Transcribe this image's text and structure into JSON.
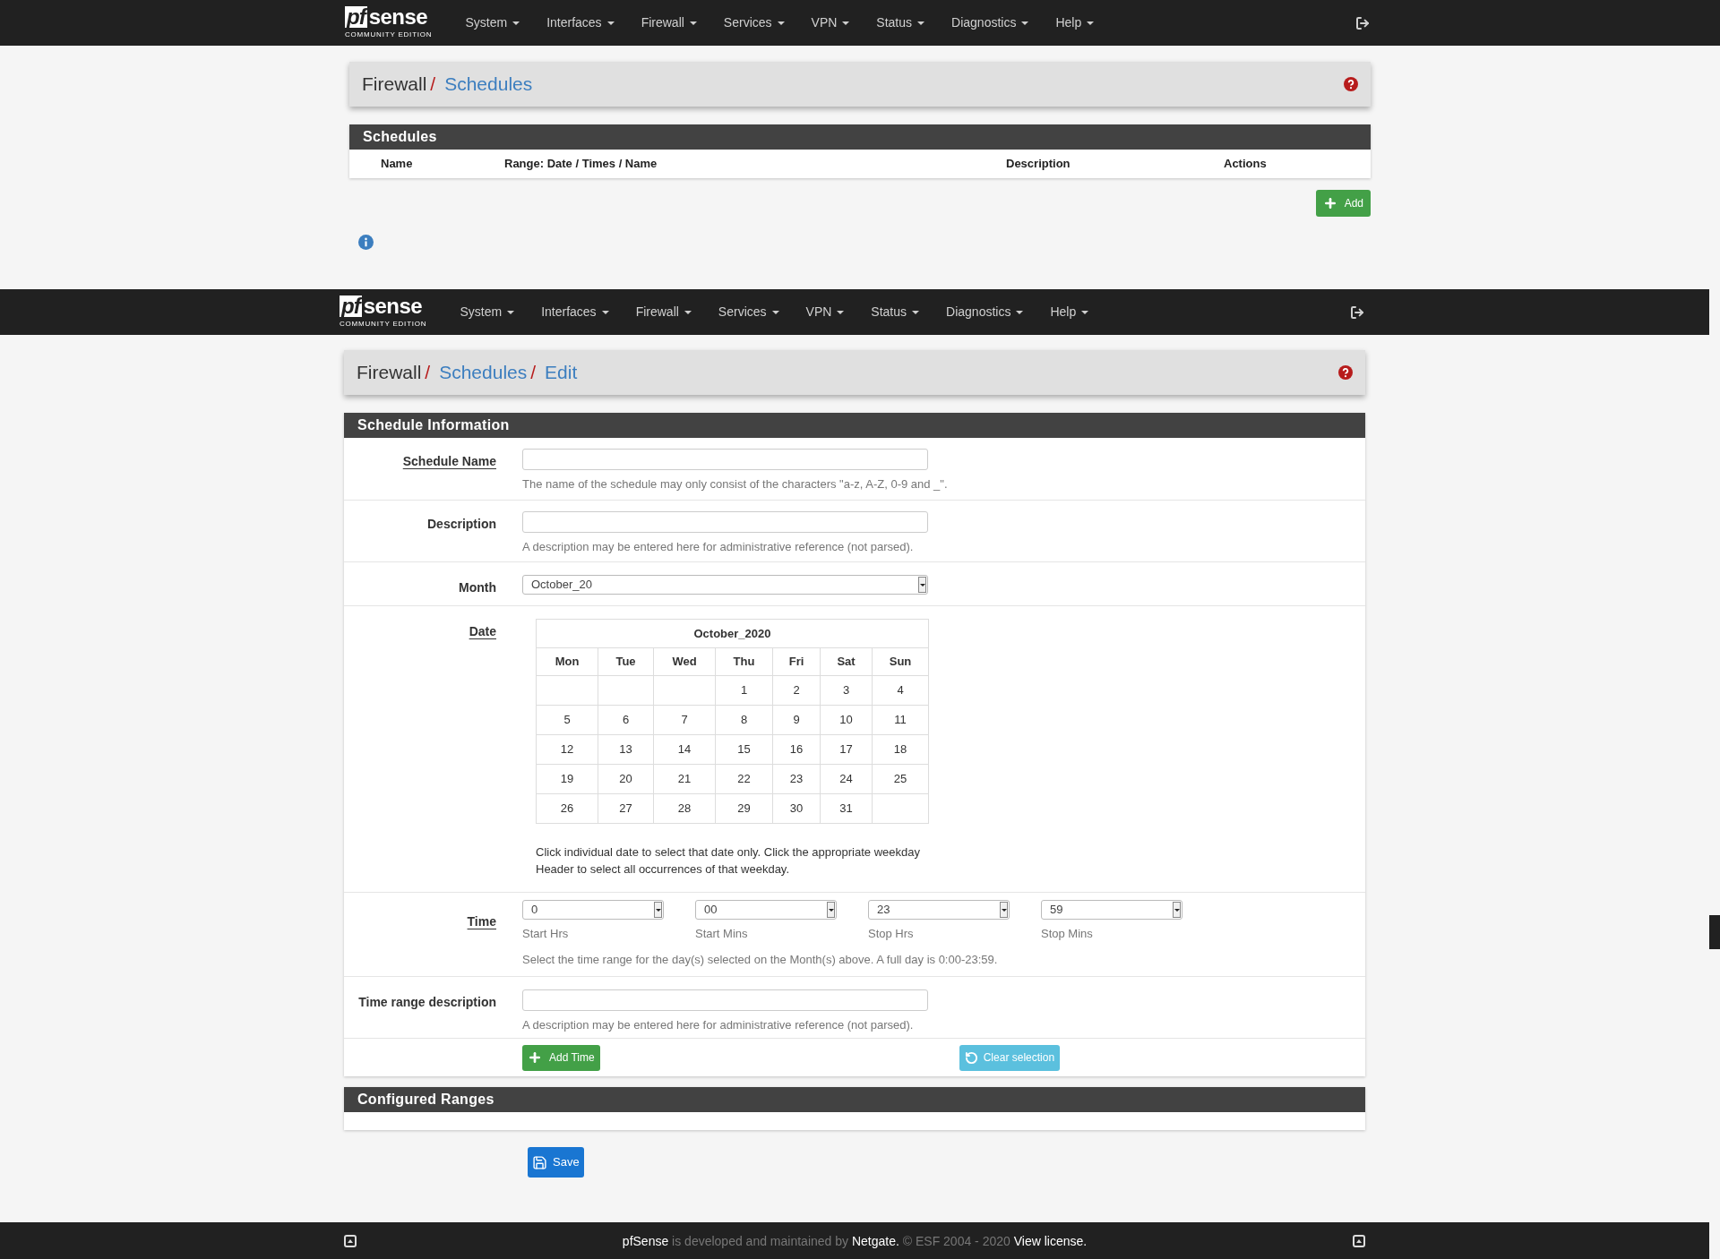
{
  "top_page": {
    "navbar": {
      "logo": {
        "mark": "pf",
        "word": "sense",
        "edition": "COMMUNITY EDITION"
      },
      "menus": [
        "System",
        "Interfaces",
        "Firewall",
        "Services",
        "VPN",
        "Status",
        "Diagnostics",
        "Help"
      ]
    },
    "breadcrumb": [
      {
        "text": "Firewall",
        "link": false
      },
      {
        "separator": "/",
        "text": "Schedules",
        "link": true
      }
    ],
    "schedules_table": {
      "title": "Schedules",
      "columns": [
        "Name",
        "Range: Date / Times / Name",
        "Description",
        "Actions"
      ]
    },
    "add_button": "Add"
  },
  "edit_page": {
    "navbar": {
      "logo": {
        "mark": "pf",
        "word": "sense",
        "edition": "COMMUNITY EDITION"
      },
      "menus": [
        "System",
        "Interfaces",
        "Firewall",
        "Services",
        "VPN",
        "Status",
        "Diagnostics",
        "Help"
      ]
    },
    "breadcrumb": [
      {
        "text": "Firewall",
        "link": false
      },
      {
        "separator": "/",
        "text": "Schedules",
        "link": true
      },
      {
        "separator": "/",
        "text": "Edit",
        "link": true
      }
    ],
    "schedule_information": {
      "title": "Schedule Information",
      "schedule_name": {
        "label": "Schedule Name",
        "underlined": true,
        "help": "The name of the schedule may only consist of the characters \"a-z, A-Z, 0-9 and _\"."
      },
      "description": {
        "label": "Description",
        "underlined": false,
        "help": "A description may be entered here for administrative reference (not parsed)."
      },
      "month": {
        "label": "Month",
        "underlined": false,
        "value": "October_20"
      },
      "date": {
        "label": "Date",
        "underlined": true,
        "calendar": {
          "title": "October_2020",
          "weekdays": [
            "Mon",
            "Tue",
            "Wed",
            "Thu",
            "Fri",
            "Sat",
            "Sun"
          ],
          "weeks": [
            [
              {
                "kind": "blank"
              },
              {
                "kind": "blank"
              },
              {
                "kind": "blank"
              },
              {
                "kind": "day",
                "text": "1"
              },
              {
                "kind": "day",
                "text": "2"
              },
              {
                "kind": "day",
                "text": "3"
              },
              {
                "kind": "day",
                "text": "4"
              }
            ],
            [
              {
                "kind": "day",
                "text": "5"
              },
              {
                "kind": "day",
                "text": "6"
              },
              {
                "kind": "day",
                "text": "7"
              },
              {
                "kind": "day",
                "text": "8"
              },
              {
                "kind": "day",
                "text": "9"
              },
              {
                "kind": "day",
                "text": "10"
              },
              {
                "kind": "day",
                "text": "11"
              }
            ],
            [
              {
                "kind": "day",
                "text": "12"
              },
              {
                "kind": "day",
                "text": "13"
              },
              {
                "kind": "day",
                "text": "14"
              },
              {
                "kind": "day",
                "text": "15"
              },
              {
                "kind": "day",
                "text": "16"
              },
              {
                "kind": "day",
                "text": "17"
              },
              {
                "kind": "day",
                "text": "18"
              }
            ],
            [
              {
                "kind": "day",
                "text": "19"
              },
              {
                "kind": "day",
                "text": "20"
              },
              {
                "kind": "day",
                "text": "21"
              },
              {
                "kind": "day",
                "text": "22"
              },
              {
                "kind": "day",
                "text": "23"
              },
              {
                "kind": "day",
                "text": "24"
              },
              {
                "kind": "day",
                "text": "25"
              }
            ],
            [
              {
                "kind": "day",
                "text": "26"
              },
              {
                "kind": "day",
                "text": "27"
              },
              {
                "kind": "day",
                "text": "28"
              },
              {
                "kind": "day",
                "text": "29"
              },
              {
                "kind": "day",
                "text": "30"
              },
              {
                "kind": "day",
                "text": "31"
              },
              {
                "kind": "blank"
              }
            ]
          ]
        },
        "help": "Click individual date to select that date only. Click the appropriate weekday Header to select all occurrences of that weekday."
      },
      "time": {
        "label": "Time",
        "underlined": true,
        "selects": [
          {
            "value": "0",
            "caption": "Start Hrs"
          },
          {
            "value": "00",
            "caption": "Start Mins"
          },
          {
            "value": "23",
            "caption": "Stop Hrs"
          },
          {
            "value": "59",
            "caption": "Stop Mins"
          }
        ],
        "help": "Select the time range for the day(s) selected on the Month(s) above. A full day is 0:00-23:59."
      },
      "time_range_description": {
        "label": "Time range description",
        "underlined": false,
        "help": "A description may be entered here for administrative reference (not parsed)."
      },
      "add_time_button": "Add Time",
      "clear_selection_button": "Clear selection"
    },
    "configured_ranges": {
      "title": "Configured Ranges"
    },
    "save_button": "Save",
    "footer": [
      {
        "text": "pfSense",
        "bright": true
      },
      {
        "text": " is developed and maintained by ",
        "bright": false
      },
      {
        "text": "Netgate.",
        "bright": true
      },
      {
        "text": " © ESF 2004 - 2020 ",
        "bright": false
      },
      {
        "text": "View license.",
        "bright": true
      }
    ]
  }
}
